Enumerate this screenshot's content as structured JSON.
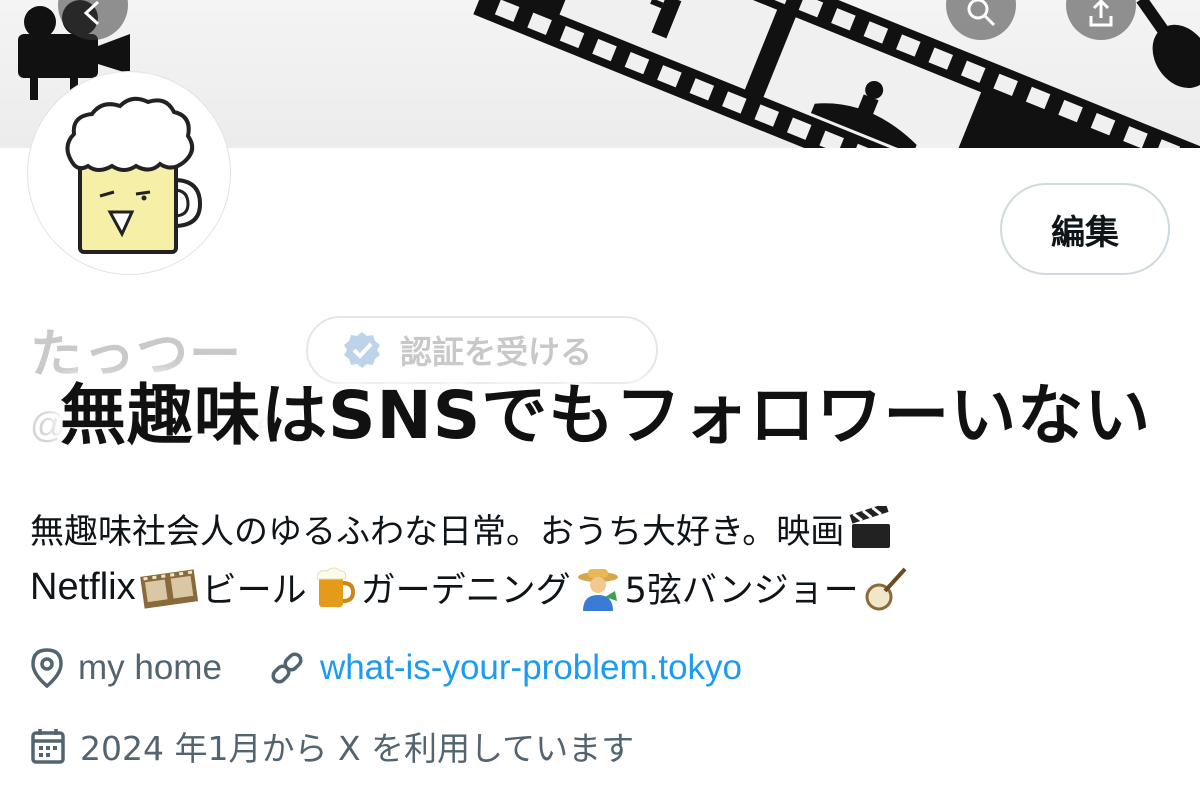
{
  "profile": {
    "display_name": "たっつー",
    "verify_button_label": "認証を受ける",
    "handle": "@Tattsu_single",
    "edit_button_label": "編集",
    "bio_line1": "無趣味社会人のゆるふわな日常。おうち大好き。映画",
    "bio_netflix": "Netflix",
    "bio_beer": "ビール",
    "bio_gardening": "ガーデニング",
    "bio_banjo": "5弦バンジョー",
    "location": "my home",
    "website": "what-is-your-problem.tokyo",
    "joined": "2024 年1月から X を利用しています"
  },
  "overlay": {
    "title": "無趣味はSNSでもフォロワーいない"
  },
  "icons": {
    "location": "location-pin-icon",
    "link": "link-icon",
    "calendar": "calendar-icon",
    "verified": "verified-badge-icon",
    "back": "back-arrow-icon",
    "search": "search-icon",
    "share": "share-icon"
  },
  "colors": {
    "text": "#0f1419",
    "muted": "#536471",
    "link": "#1d9bf0",
    "border": "#cfd9de"
  }
}
